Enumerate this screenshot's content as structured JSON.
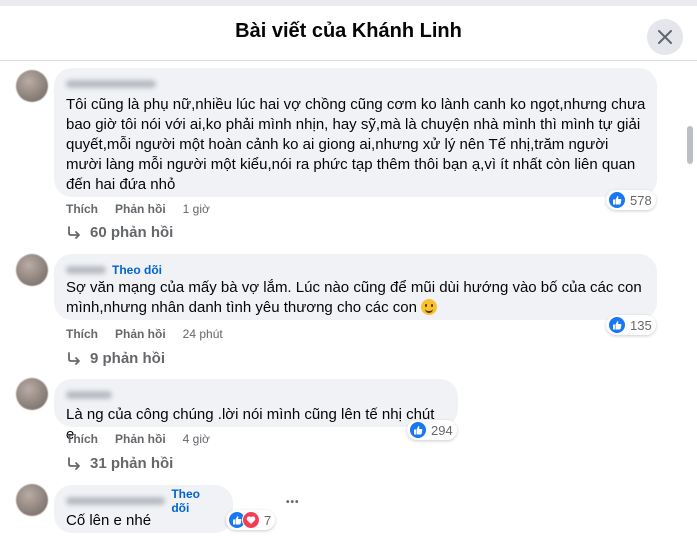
{
  "header": {
    "title": "Bài viết của Khánh Linh"
  },
  "comments": [
    {
      "author": "Quyên Phương",
      "text": "Tôi cũng là phụ nữ,nhiều lúc hai vợ chồng cũng cơm ko lành canh ko ngọt,nhưng chưa bao giờ tôi nói với ai,ko phải mình nhịn, hay sỹ,mà là chuyện nhà mình thì mình tự giải quyết,mỗi người một hoàn cảnh ko ai giong ai,nhưng xử lý nên Tế nhị,trăm người mười làng mỗi người một kiểu,nói ra phức tạp thêm thôi bạn ạ,vì ít nhất còn liên quan đến hai đứa nhỏ",
      "like_label": "Thích",
      "reply_label": "Phản hồi",
      "time": "1 giờ",
      "reactions": "578",
      "replies": "60 phản hồi"
    },
    {
      "follow": "Theo dõi",
      "text": "Sợ văn mạng của mấy bà vợ lắm. Lúc nào cũng để mũi dùi hướng vào bố của các con mình,nhưng nhân danh tình yêu thương cho các con",
      "like_label": "Thích",
      "reply_label": "Phản hồi",
      "time": "24 phút",
      "reactions": "135",
      "replies": "9 phản hồi"
    },
    {
      "text": "Là ng của công chúng .lời nói mình cũng lên tế nhị chút e",
      "like_label": "Thích",
      "reply_label": "Phản hồi",
      "time": "4 giờ",
      "reactions": "294",
      "replies": "31 phản hồi"
    },
    {
      "follow": "Theo dõi",
      "text": "Cố lên e nhé",
      "reactions": "7",
      "more": "•••"
    }
  ],
  "icons": {
    "close": "close-icon",
    "like": "like-icon",
    "heart": "heart-icon",
    "reply_arrow": "reply-arrow-icon",
    "emoji": "smile-emoji-icon"
  },
  "colors": {
    "like_blue": "#1877f2",
    "follow_blue": "#0064d1",
    "bubble_bg": "#f0f2f5",
    "muted_text": "#65676b"
  }
}
